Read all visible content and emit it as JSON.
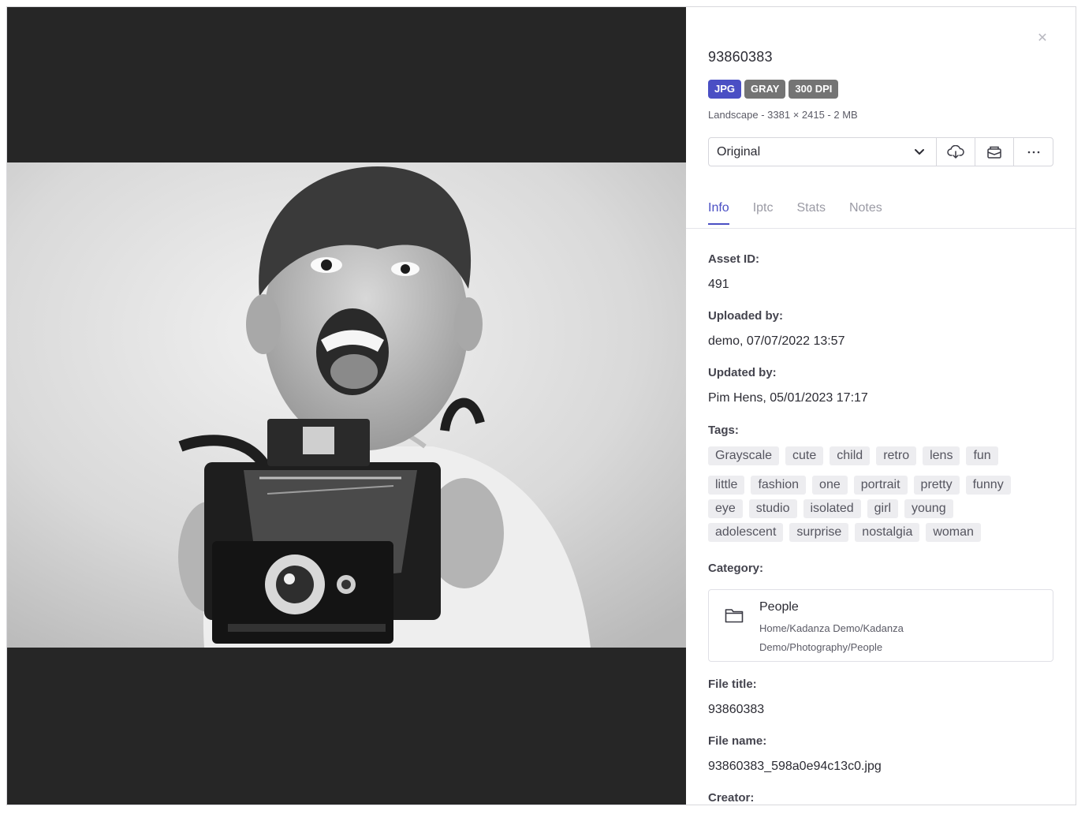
{
  "asset": {
    "title": "93860383",
    "badges": [
      "JPG",
      "GRAY",
      "300 DPI"
    ],
    "meta_line": "Landscape - 3381 × 2415 - 2 MB"
  },
  "toolbar": {
    "selected_version": "Original",
    "buttons": [
      "cloud-download-icon",
      "mail-box-icon",
      "more-icon"
    ]
  },
  "tabs": [
    {
      "label": "Info",
      "active": true
    },
    {
      "label": "Iptc",
      "active": false
    },
    {
      "label": "Stats",
      "active": false
    },
    {
      "label": "Notes",
      "active": false
    }
  ],
  "info": {
    "asset_id_label": "Asset ID:",
    "asset_id": "491",
    "uploaded_by_label": "Uploaded by:",
    "uploaded_by": "demo, 07/07/2022 13:57",
    "updated_by_label": "Updated by:",
    "updated_by": "Pim Hens, 05/01/2023 17:17",
    "tags_label": "Tags:",
    "tags": [
      "Grayscale",
      "cute",
      "child",
      "retro",
      "lens",
      "fun",
      "little",
      "fashion",
      "one",
      "portrait",
      "pretty",
      "funny",
      "eye",
      "studio",
      "isolated",
      "girl",
      "young",
      "adolescent",
      "surprise",
      "nostalgia",
      "woman"
    ],
    "category_label": "Category:",
    "category_name": "People",
    "category_path": "Home/Kadanza Demo/Kadanza Demo/Photography/People",
    "file_title_label": "File title:",
    "file_title": "93860383",
    "file_name_label": "File name:",
    "file_name": "93860383_598a0e94c13c0.jpg",
    "creator_label": "Creator:"
  },
  "colors": {
    "accent": "#4a4fc4",
    "badge_gray": "#747474",
    "viewer_bg": "#262626"
  }
}
